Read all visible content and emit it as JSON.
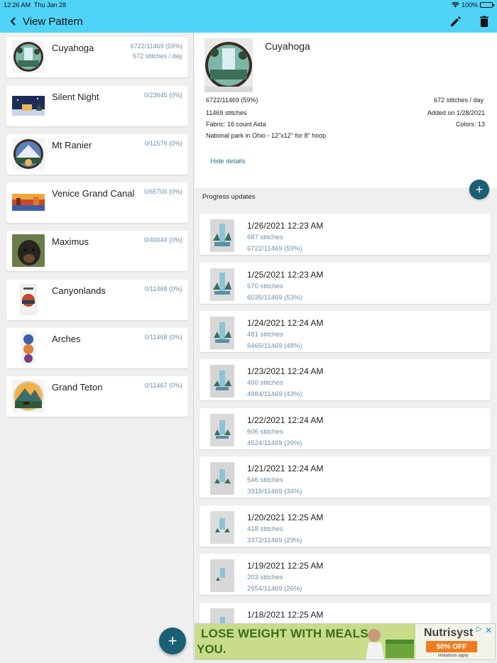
{
  "status": {
    "time": "12:26 AM",
    "date": "Thu Jan 28",
    "battery": "100%"
  },
  "appbar": {
    "title": "View Pattern",
    "back_icon": "chevron-left-icon",
    "edit_icon": "pencil-icon",
    "delete_icon": "trash-icon"
  },
  "patterns": [
    {
      "name": "Cuyahoga",
      "progress": "6722/11469 (59%)",
      "rate": "672 stitches / day"
    },
    {
      "name": "Silent Night",
      "progress": "0/23645 (0%)",
      "rate": ""
    },
    {
      "name": "Mt Ranier",
      "progress": "0/11576 (0%)",
      "rate": ""
    },
    {
      "name": "Venice Grand Canal",
      "progress": "0/65700 (0%)",
      "rate": ""
    },
    {
      "name": "Maximus",
      "progress": "0/40044 (0%)",
      "rate": ""
    },
    {
      "name": "Canyonlands",
      "progress": "0/11468 (0%)",
      "rate": ""
    },
    {
      "name": "Arches",
      "progress": "0/11468 (0%)",
      "rate": ""
    },
    {
      "name": "Grand Teton",
      "progress": "0/11467 (0%)",
      "rate": ""
    }
  ],
  "detail": {
    "title": "Cuyahoga",
    "progress": "6722/11469 (59%)",
    "rate": "672 stitches / day",
    "stitches": "11469 stitches",
    "added": "Added on 1/28/2021",
    "fabric": "Fabric: 16 count Aida",
    "colors": "Colors: 13",
    "description": "National park in Ohio - 12\"x12\" for 8\" hoop",
    "hide_details": "Hide details"
  },
  "progress_header": "Progress updates",
  "updates": [
    {
      "date": "1/26/2021 12:23 AM",
      "stitches": "687 stitches",
      "total": "6722/11469 (59%)"
    },
    {
      "date": "1/25/2021 12:23 AM",
      "stitches": "570 stitches",
      "total": "6035/11469 (53%)"
    },
    {
      "date": "1/24/2021 12:24 AM",
      "stitches": "481 stitches",
      "total": "5465/11469 (48%)"
    },
    {
      "date": "1/23/2021 12:24 AM",
      "stitches": "460 stitches",
      "total": "4984/11469 (43%)"
    },
    {
      "date": "1/22/2021 12:24 AM",
      "stitches": "606 stitches",
      "total": "4524/11469 (39%)"
    },
    {
      "date": "1/21/2021 12:24 AM",
      "stitches": "546 stitches",
      "total": "3918/11469 (34%)"
    },
    {
      "date": "1/20/2021 12:25 AM",
      "stitches": "418 stitches",
      "total": "3372/11469 (29%)"
    },
    {
      "date": "1/19/2021 12:25 AM",
      "stitches": "203 stitches",
      "total": "2954/11469 (26%)"
    },
    {
      "date": "1/18/2021 12:25 AM",
      "stitches": "",
      "total": ""
    }
  ],
  "ad": {
    "headline": "LOSE WEIGHT WITH MEALS",
    "sub": "YOU.",
    "brand": "Nutrisyst",
    "offer": "50% OFF",
    "fine": "limitations apply"
  },
  "colors": {
    "appbar": "#4fd3f7",
    "fab": "#1b5f75",
    "link": "#2a6f8f",
    "muted_text": "#6b8fa8"
  }
}
